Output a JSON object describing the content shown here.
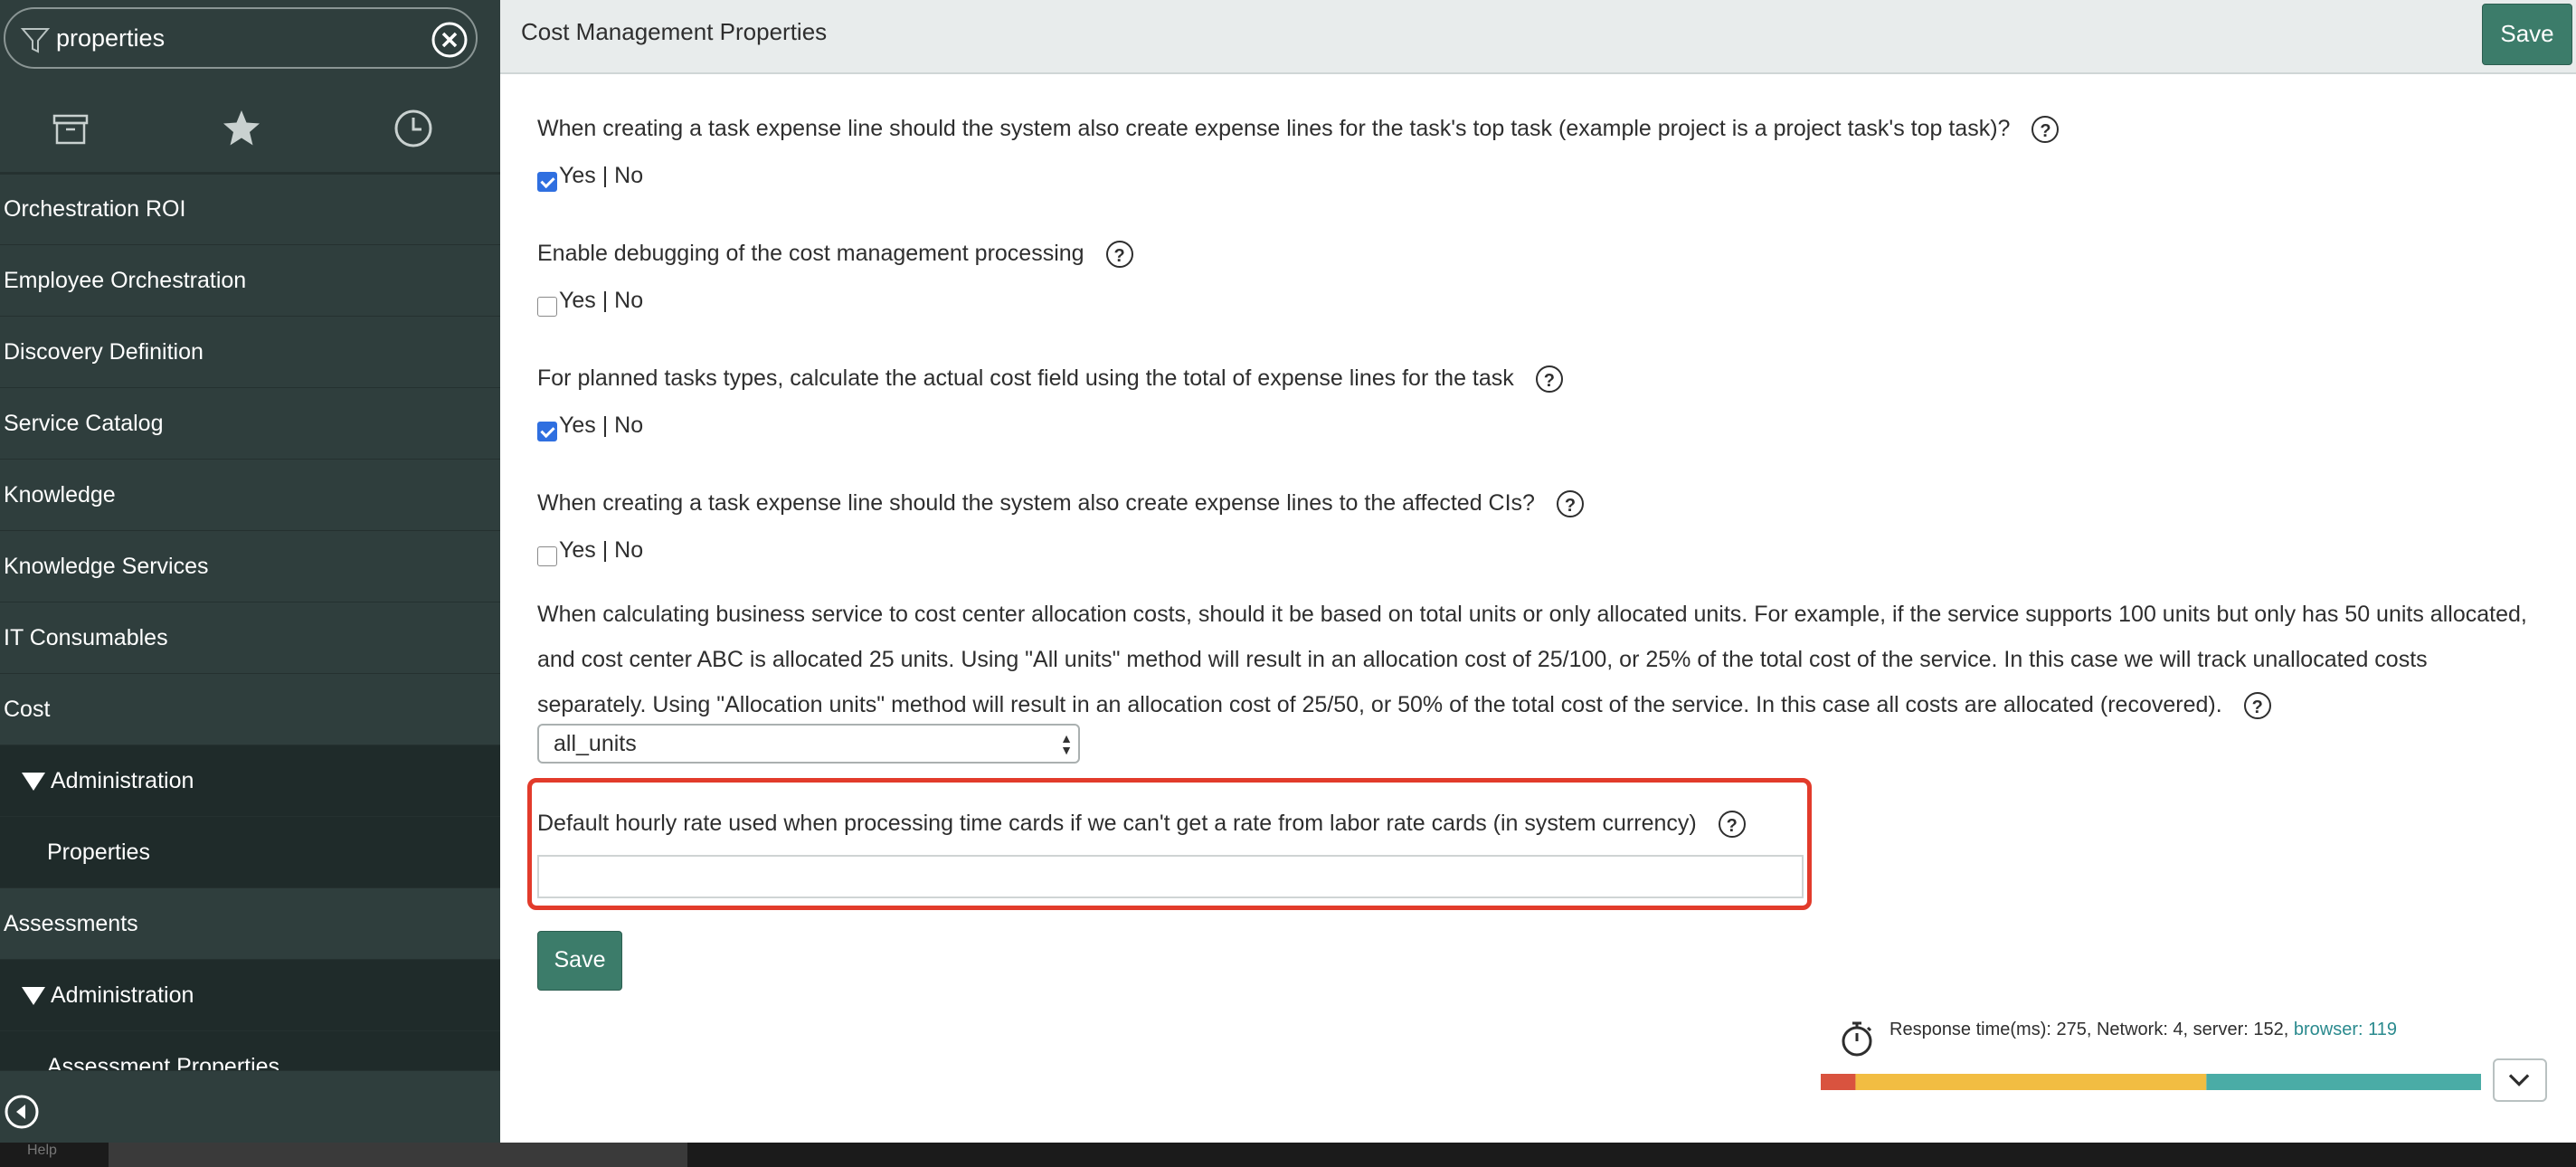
{
  "sidebar": {
    "filter_text": "properties",
    "nav_items": [
      {
        "label": "Orchestration ROI",
        "kind": "top"
      },
      {
        "label": "Employee Orchestration",
        "kind": "top"
      },
      {
        "label": "Discovery Definition",
        "kind": "top"
      },
      {
        "label": "Service Catalog",
        "kind": "top"
      },
      {
        "label": "Knowledge",
        "kind": "top"
      },
      {
        "label": "Knowledge Services",
        "kind": "top"
      },
      {
        "label": "IT Consumables",
        "kind": "top"
      },
      {
        "label": "Cost",
        "kind": "top"
      },
      {
        "label": "Administration",
        "kind": "sub"
      },
      {
        "label": "Properties",
        "kind": "leaf"
      },
      {
        "label": "Assessments",
        "kind": "top"
      },
      {
        "label": "Administration",
        "kind": "sub"
      },
      {
        "label": "Assessment Properties",
        "kind": "leaf"
      }
    ]
  },
  "taskbar": {
    "help_text": "Help"
  },
  "header": {
    "title": "Cost Management Properties",
    "save_label": "Save"
  },
  "properties": {
    "q1": {
      "text": "When creating a task expense line should the system also create expense lines for the task's top task (example project is a project task's top task)?",
      "yes_no": "Yes | No",
      "checked": true
    },
    "q2": {
      "text": "Enable debugging of the cost management processing",
      "yes_no": "Yes | No",
      "checked": false
    },
    "q3": {
      "text": "For planned tasks types, calculate the actual cost field using the total of expense lines for the task",
      "yes_no": "Yes | No",
      "checked": true
    },
    "q4": {
      "text": "When creating a task expense line should the system also create expense lines to the affected CIs?",
      "yes_no": "Yes | No",
      "checked": false
    },
    "q5": {
      "text": "When calculating business service to cost center allocation costs, should it be based on total units or only allocated units. For example, if the service supports 100 units but only has 50 units allocated, and cost center ABC is allocated 25 units. Using \"All units\" method will result in an allocation cost of 25/100, or 25% of the total cost of the service. In this case we will track unallocated costs separately. Using \"Allocation units\" method will result in an allocation cost of 25/50, or 50% of the total cost of the service. In this case all costs are allocated (recovered).",
      "select_value": "all_units"
    },
    "q6": {
      "text": "Default hourly rate used when processing time cards if we can't get a rate from labor rate cards (in system currency)",
      "input_value": ""
    },
    "help_glyph": "?"
  },
  "footer": {
    "save_label": "Save",
    "perf_prefix": "Response time(ms): 275, Network: 4, server: 152,",
    "perf_browser": "browser: 119",
    "perf_segments": [
      {
        "name": "network",
        "color": "#d9533f",
        "value": 4
      },
      {
        "name": "server",
        "color": "#f2bd42",
        "value": 152
      },
      {
        "name": "browser",
        "color": "#4aaca6",
        "value": 119
      }
    ]
  },
  "colors": {
    "sidebar_bg": "#2f3e3d",
    "accent": "#3c7c6a",
    "highlight": "#e23b2b",
    "checkbox": "#2f6fe0"
  }
}
